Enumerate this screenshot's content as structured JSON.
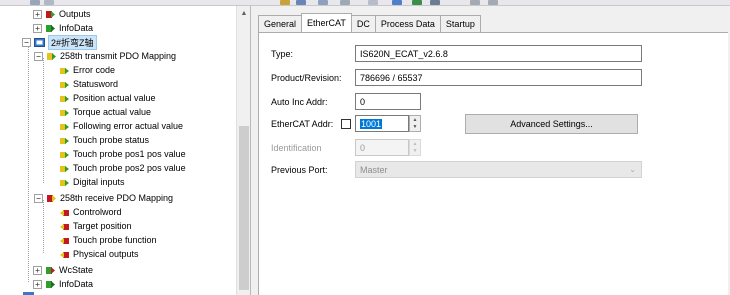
{
  "colors": {
    "selection_bg": "#cce4f7",
    "spin_highlight": "#0078d7",
    "icon_green": "#2e9e2e",
    "icon_red": "#c21a1a",
    "icon_yellow": "#e6c21c"
  },
  "tree": {
    "items": [
      {
        "label": "Outputs",
        "icon": "outputs-var-icon",
        "expander": "+"
      },
      {
        "label": "InfoData",
        "icon": "infodata-var-icon",
        "expander": "+"
      },
      {
        "label": "2#折弯Z轴",
        "icon": "ethercat-box-icon",
        "expander": "−",
        "selected": true
      },
      {
        "label": "258th transmit PDO Mapping",
        "icon": "input-pdo-icon",
        "expander": "−"
      },
      {
        "label": "Error code",
        "icon": "input-var-icon"
      },
      {
        "label": "Statusword",
        "icon": "input-var-icon"
      },
      {
        "label": "Position actual value",
        "icon": "input-var-icon"
      },
      {
        "label": "Torque actual value",
        "icon": "input-var-icon"
      },
      {
        "label": "Following error actual value",
        "icon": "input-var-icon"
      },
      {
        "label": "Touch probe status",
        "icon": "input-var-icon"
      },
      {
        "label": "Touch probe pos1 pos value",
        "icon": "input-var-icon"
      },
      {
        "label": "Touch probe pos2 pos value",
        "icon": "input-var-icon"
      },
      {
        "label": "Digital inputs",
        "icon": "input-var-icon"
      },
      {
        "label": "258th receive PDO Mapping",
        "icon": "output-pdo-icon",
        "expander": "−"
      },
      {
        "label": "Controlword",
        "icon": "output-var-icon"
      },
      {
        "label": "Target position",
        "icon": "output-var-icon"
      },
      {
        "label": "Touch probe function",
        "icon": "output-var-icon"
      },
      {
        "label": "Physical outputs",
        "icon": "output-var-icon"
      },
      {
        "label": "WcState",
        "icon": "wcstate-var-icon",
        "expander": "+"
      },
      {
        "label": "InfoData",
        "icon": "infodata-var-icon",
        "expander": "+"
      }
    ]
  },
  "tabs": [
    "General",
    "EtherCAT",
    "DC",
    "Process Data",
    "Startup"
  ],
  "active_tab": "EtherCAT",
  "form": {
    "type_label": "Type:",
    "type_value": "IS620N_ECAT_v2.6.8",
    "product_label": "Product/Revision:",
    "product_value": "786696 / 65537",
    "auto_inc_label": "Auto Inc Addr:",
    "auto_inc_value": "0",
    "ethercat_addr_label": "EtherCAT Addr:",
    "ethercat_addr_value": "1001",
    "ethercat_addr_checked": false,
    "advanced_button": "Advanced Settings...",
    "identification_label": "Identification",
    "identification_value": "0",
    "previous_port_label": "Previous Port:",
    "previous_port_value": "Master"
  }
}
